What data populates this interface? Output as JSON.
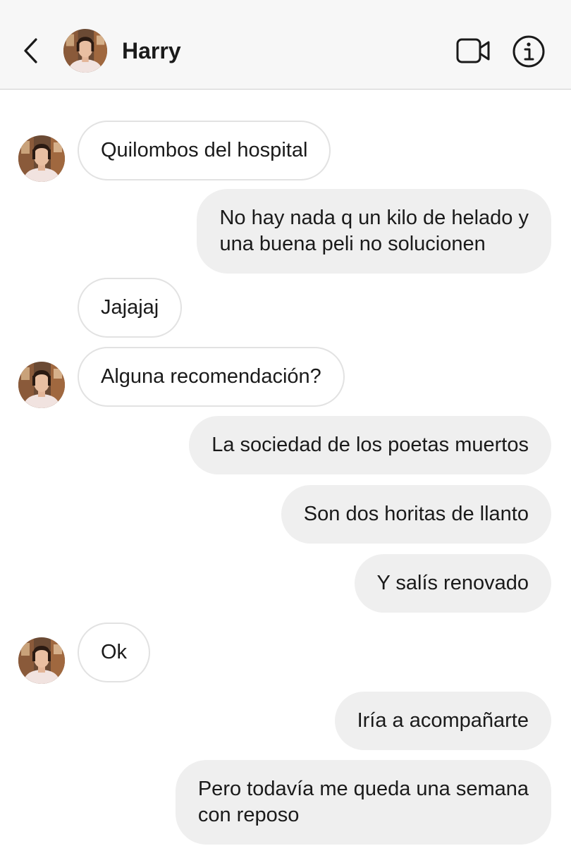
{
  "header": {
    "contact_name": "Harry",
    "back_icon": "chevron-left-icon",
    "video_icon": "video-camera-icon",
    "info_icon": "info-icon"
  },
  "messages": [
    {
      "direction": "incoming",
      "text": "Quilombos del hospital"
    },
    {
      "direction": "outgoing",
      "lines": [
        "No hay nada q un kilo de helado y",
        "una buena peli no solucionen"
      ]
    },
    {
      "direction": "incoming",
      "text": "Jajajaj"
    },
    {
      "direction": "incoming",
      "text": "Alguna recomendación?"
    },
    {
      "direction": "outgoing",
      "text": "La sociedad de los poetas muertos"
    },
    {
      "direction": "outgoing",
      "text": "Son dos horitas de llanto"
    },
    {
      "direction": "outgoing",
      "text": "Y salís renovado"
    },
    {
      "direction": "incoming",
      "text": "Ok"
    },
    {
      "direction": "outgoing",
      "text": "Iría a acompañarte"
    },
    {
      "direction": "outgoing",
      "lines": [
        "Pero todavía me queda una semana",
        "con reposo"
      ]
    }
  ],
  "colors": {
    "header_bg": "#f7f7f7",
    "incoming_bubble_bg": "#ffffff",
    "incoming_bubble_border": "#e2e2e2",
    "outgoing_bubble_bg": "#efefef",
    "text": "#1a1a1a"
  }
}
